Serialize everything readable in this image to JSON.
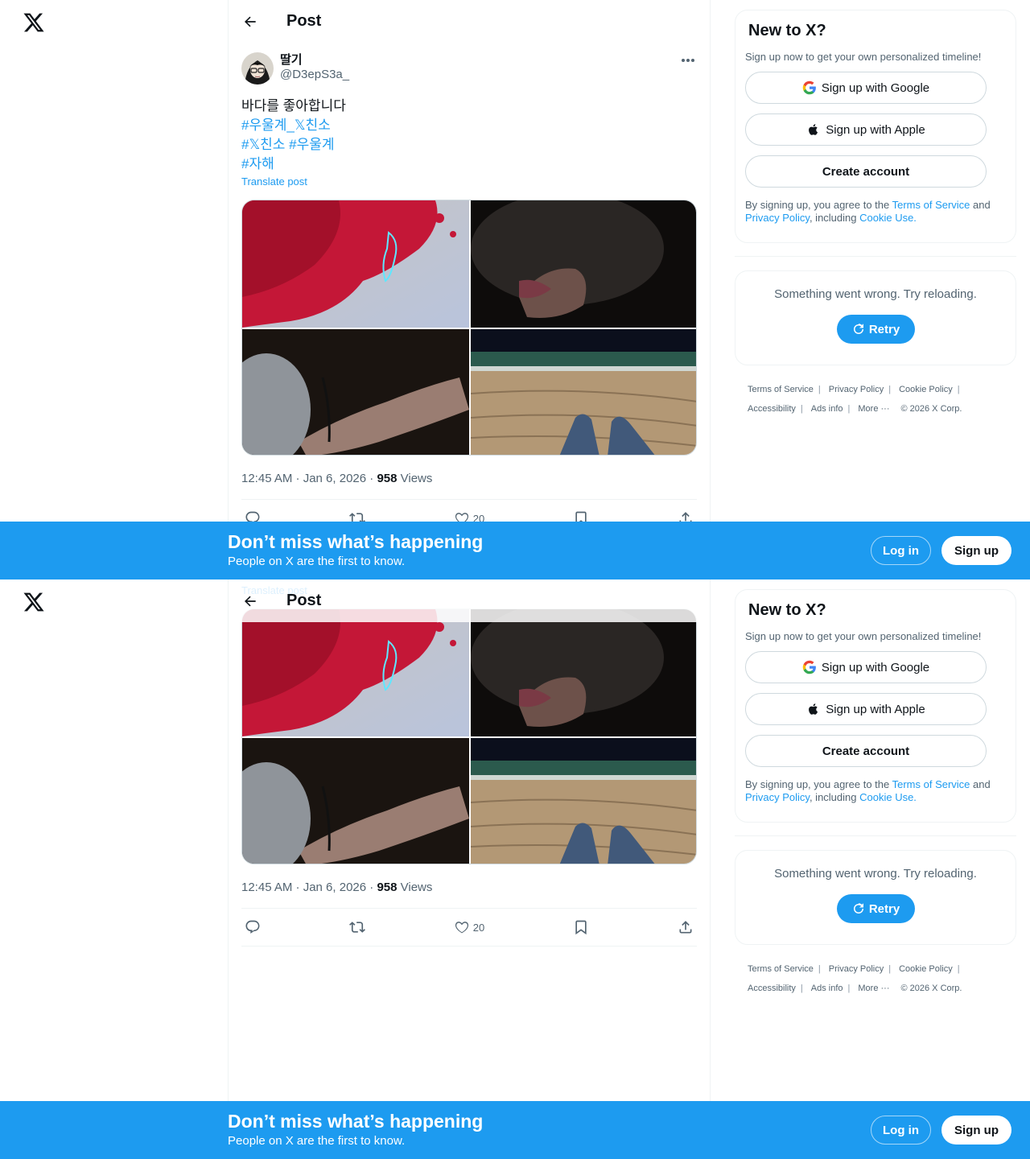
{
  "topbar": {
    "title": "Post"
  },
  "post": {
    "display_name": "딸기",
    "handle": "@D3epS3a_",
    "text_line1": "바다를 좋아합니다",
    "hashtags_line2": "#우울계_𝕏친소",
    "hashtags_line3a": "#𝕏친소",
    "hashtags_line3b": "#우울계",
    "hashtags_line4": "#자해",
    "translate": "Translate post",
    "time": "12:45 AM · Jan 6, 2026 · ",
    "views_count": "958",
    "views_label": " Views",
    "likes": "20"
  },
  "sidebar": {
    "signup_title": "New to X?",
    "signup_sub": "Sign up now to get your own personalized timeline!",
    "google_label": "Sign up with Google",
    "apple_label": "Sign up with Apple",
    "create_label": "Create account",
    "terms_prefix": "By signing up, you agree to the ",
    "terms_tos": "Terms of Service",
    "terms_and": " and",
    "terms_privacy": "Privacy Policy",
    "terms_including": ", including ",
    "terms_cookie": "Cookie Use.",
    "error_text": "Something went wrong. Try reloading.",
    "retry_label": "Retry"
  },
  "footer": {
    "tos": "Terms of Service",
    "privacy": "Privacy Policy",
    "cookie": "Cookie Policy",
    "accessibility": "Accessibility",
    "ads": "Ads info",
    "more": "More ···",
    "copyright": "© 2026 X Corp.",
    "sep": "|"
  },
  "banner": {
    "title": "Don’t miss what’s happening",
    "subtitle": "People on X are the first to know.",
    "login": "Log in",
    "signup": "Sign up"
  },
  "colors": {
    "accent": "#1d9bf0",
    "text": "#0f1419",
    "secondary": "#536471",
    "border": "#eff3f4"
  },
  "icons": [
    "x-logo-icon",
    "back-arrow-icon",
    "more-icon",
    "reply-icon",
    "repost-icon",
    "like-icon",
    "bookmark-icon",
    "share-icon",
    "google-icon",
    "apple-icon",
    "refresh-icon"
  ]
}
